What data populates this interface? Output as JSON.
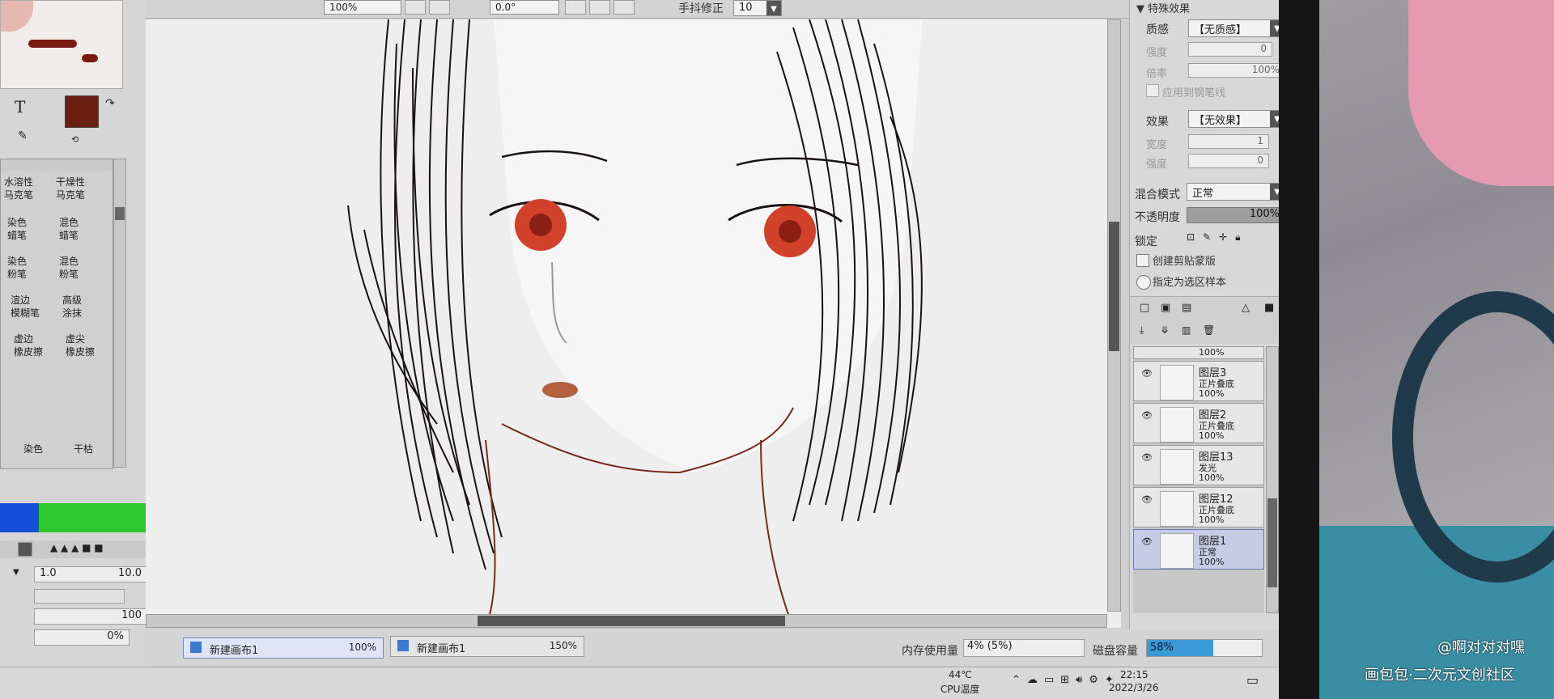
{
  "toolbar": {
    "zoom": "100%",
    "angle": "0.0°",
    "stabilizer_label": "手抖修正",
    "stabilizer_value": "10"
  },
  "tools": {
    "text_tool": "T",
    "brushes": [
      {
        "label": "水溶性\n马克笔"
      },
      {
        "label": "干燥性\n马克笔"
      },
      {
        "label": "染色\n蜡笔"
      },
      {
        "label": "混色\n蜡笔"
      },
      {
        "label": "染色\n粉笔"
      },
      {
        "label": "混色\n粉笔"
      },
      {
        "label": "渲边\n模糊笔"
      },
      {
        "label": "高级\n涂抹"
      },
      {
        "label": "虚边\n橡皮擦"
      },
      {
        "label": "虚尖\n橡皮擦"
      },
      {
        "label": "染色"
      },
      {
        "label": "干枯"
      }
    ],
    "size_value": "1.0",
    "size_max": "10.0",
    "opacity_value": "100",
    "percent_value": "0%"
  },
  "effects": {
    "header": "特殊效果",
    "texture_label": "质感",
    "texture_value": "【无质感】",
    "strength_label": "强度",
    "strength_value": "0",
    "scale_label": "倍率",
    "scale_value": "100%",
    "apply_label": "应用到钢笔线",
    "effect_label": "效果",
    "effect_value": "【无效果】",
    "width_label": "宽度",
    "width_value": "1",
    "intensity_label": "强度",
    "intensity_value": "0"
  },
  "layer_props": {
    "blend_label": "混合模式",
    "blend_value": "正常",
    "opacity_label": "不透明度",
    "opacity_value": "100%",
    "lock_label": "锁定",
    "clip_label": "创建剪贴蒙版",
    "sample_label": "指定为选区样本"
  },
  "layers": [
    {
      "name": "图层3",
      "mode": "正片叠底",
      "opacity": "100%"
    },
    {
      "name": "图层2",
      "mode": "正片叠底",
      "opacity": "100%"
    },
    {
      "name": "图层13",
      "mode": "发光",
      "opacity": "100%"
    },
    {
      "name": "图层12",
      "mode": "正片叠底",
      "opacity": "100%"
    },
    {
      "name": "图层1",
      "mode": "正常",
      "opacity": "100%"
    }
  ],
  "layer_top_partial": "100%",
  "canvas_tabs": [
    {
      "name": "新建画布1",
      "zoom": "100%"
    },
    {
      "name": "新建画布1",
      "zoom": "150%"
    }
  ],
  "status": {
    "memory_label": "内存使用量",
    "memory_value": "4% (5%)",
    "disk_label": "磁盘容量",
    "disk_value": "58%",
    "disk_fraction": 0.58
  },
  "taskbar": {
    "cpu_temp": "44℃",
    "cpu_label": "CPU温度",
    "time": "22:15",
    "date": "2022/3/26"
  },
  "watermark": {
    "user": "@啊对对对嘿",
    "site": "画包包·二次元文创社区"
  },
  "colors": {
    "main_color": "#6b1f12",
    "iris": "#d2412a"
  }
}
